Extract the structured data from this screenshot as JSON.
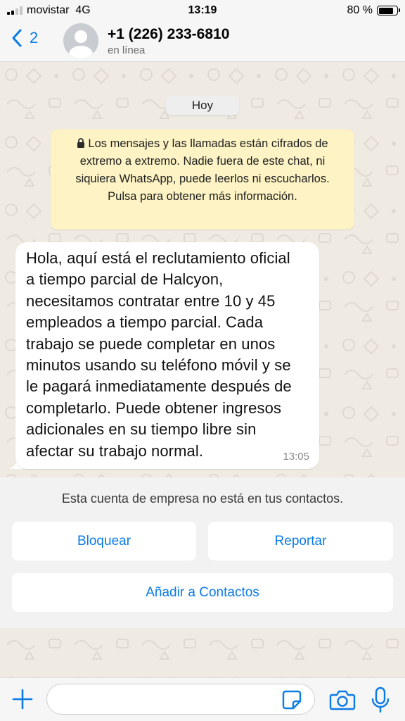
{
  "status_bar": {
    "carrier": "movistar",
    "network": "4G",
    "time": "13:19",
    "battery_percent": "80 %",
    "battery_level": 0.8,
    "signal_bars": 2
  },
  "header": {
    "back_count": "2",
    "contact_name": "+1 (226) 233-6810",
    "contact_status": "en línea"
  },
  "chat": {
    "day_label": "Hoy",
    "e2e_notice": "Los mensajes y las llamadas están cifrados de extremo a extremo. Nadie fuera de este chat, ni siquiera WhatsApp, puede leerlos ni escucharlos. Pulsa para obtener más información.",
    "messages": [
      {
        "text_lines": [
          "Hola, aquí está el reclutamiento oficial",
          "a tiempo parcial de Halcyon,",
          "necesitamos contratar entre 10 y 45",
          "empleados a tiempo parcial. Cada",
          "trabajo se puede completar en unos",
          "minutos usando su teléfono móvil y se",
          "le pagará inmediatamente después de",
          "completarlo. Puede obtener ingresos",
          "adicionales en su tiempo libre sin",
          "afectar su trabajo normal."
        ],
        "time": "13:05",
        "direction": "incoming"
      }
    ]
  },
  "business_panel": {
    "info_text": "Esta cuenta de empresa no está en tus contactos.",
    "block_label": "Bloquear",
    "report_label": "Reportar",
    "add_contact_label": "Añadir a Contactos"
  },
  "input_bar": {
    "placeholder": "",
    "icons": [
      "plus-icon",
      "sticker-icon",
      "camera-icon",
      "microphone-icon"
    ]
  },
  "colors": {
    "accent": "#0b7be6",
    "notice_bg": "#fdf3c4",
    "chat_bg": "#efeae2",
    "bubble_bg": "#ffffff"
  }
}
